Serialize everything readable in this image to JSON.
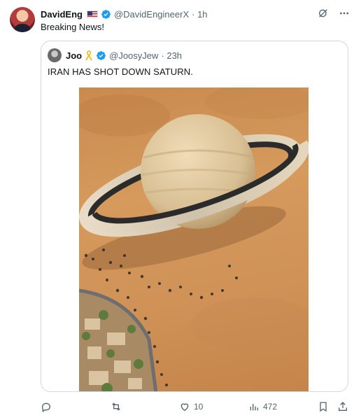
{
  "author": {
    "name": "DavidEng",
    "handle": "@DavidEngineerX",
    "time": "· 1h",
    "flag_icon": "us-flag-icon",
    "verified_color": "#1d9bf0"
  },
  "tweet": {
    "text": "Breaking News!"
  },
  "quoted": {
    "name": "Joo",
    "handle": "@JoosyJew",
    "time": "· 23h",
    "text": "IRAN HAS SHOT DOWN SATURN."
  },
  "actions": {
    "reply_count": "",
    "retweet_count": "",
    "like_count": "10",
    "views_count": "472"
  },
  "colors": {
    "muted": "#536471",
    "border": "#cfd9de",
    "sand": "#d69a5d"
  }
}
